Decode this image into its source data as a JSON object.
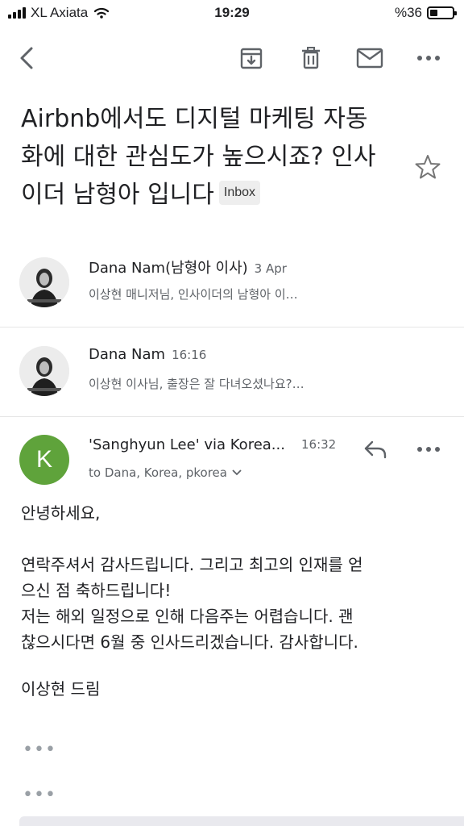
{
  "status_bar": {
    "carrier": "XL Axiata",
    "time": "19:29",
    "battery_percent": "%36",
    "battery_level": 0.36
  },
  "toolbar": {
    "icons": [
      "back-arrow-icon",
      "archive-icon",
      "delete-icon",
      "mail-icon",
      "more-icon"
    ]
  },
  "subject": {
    "text": "Airbnb에서도 디지털 마케팅 자동화에 대한 관심도가 높으시죠? 인사이더 남형아 입니다",
    "line1": "Airbnb에서도 디지털 마케팅 자동",
    "line2": "화에 대한 관심도가 높으시죠? 인사",
    "line3": "이더 남형아 입니다",
    "label": "Inbox"
  },
  "messages": [
    {
      "sender": "Dana Nam(남형아 이사)",
      "date": "3 Apr",
      "snippet": "이상현 매니저님, 인사이더의 남형아 이…"
    },
    {
      "sender": "Dana Nam",
      "date": "16:16",
      "snippet": "이상현 이사님, 출장은 잘 다녀오셨나요?…"
    }
  ],
  "open_message": {
    "avatar_letter": "K",
    "avatar_color": "#5fa33b",
    "sender": "'Sanghyun Lee' via Korea...",
    "time": "16:32",
    "to_line": "to Dana, Korea, pkorea",
    "body": {
      "greeting": "안녕하세요,",
      "p1_l1": "연락주셔서 감사드립니다. 그리고 최고의 인재를 얻",
      "p1_l2": "으신 점 축하드립니다!",
      "p1_l3": "저는 해외 일정으로 인해 다음주는 어렵습니다.  괜",
      "p1_l4": "찮으시다면 6월 중 인사드리겠습니다. 감사합니다.",
      "signature": "이상현 드림"
    },
    "trimmed_1": "•••",
    "trimmed_2": "•••"
  }
}
